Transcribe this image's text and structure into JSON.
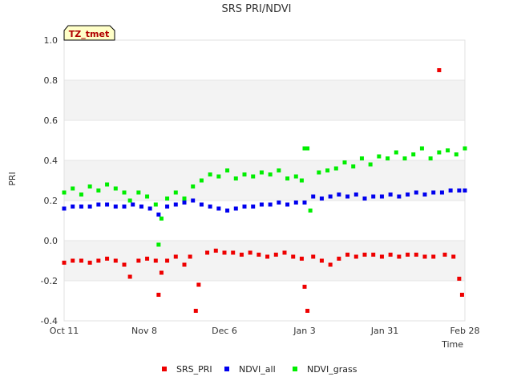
{
  "chart_data": {
    "type": "scatter",
    "title": "SRS PRI/NDVI",
    "badge": "TZ_tmet",
    "xlabel": "Time",
    "ylabel": "PRI",
    "xlim": [
      "2021-10-11",
      "2022-02-28"
    ],
    "ylim": [
      -0.4,
      1.0
    ],
    "x_ticks": [
      "Oct 11",
      "Nov 8",
      "Dec 6",
      "Jan 3",
      "Jan 31",
      "Feb 28"
    ],
    "y_ticks": [
      "-0.4",
      "-0.2",
      "0.0",
      "0.2",
      "0.4",
      "0.6",
      "0.8",
      "1.0"
    ],
    "legend_position": "bottom-center",
    "grid": "alternating horizontal bands",
    "series": [
      {
        "name": "SRS_PRI",
        "color": "#ee0000",
        "points": [
          [
            "2021-10-11",
            -0.11
          ],
          [
            "2021-10-14",
            -0.1
          ],
          [
            "2021-10-17",
            -0.1
          ],
          [
            "2021-10-20",
            -0.11
          ],
          [
            "2021-10-23",
            -0.1
          ],
          [
            "2021-10-26",
            -0.09
          ],
          [
            "2021-10-29",
            -0.1
          ],
          [
            "2021-11-01",
            -0.12
          ],
          [
            "2021-11-03",
            -0.18
          ],
          [
            "2021-11-06",
            -0.1
          ],
          [
            "2021-11-09",
            -0.09
          ],
          [
            "2021-11-12",
            -0.1
          ],
          [
            "2021-11-13",
            -0.27
          ],
          [
            "2021-11-14",
            -0.16
          ],
          [
            "2021-11-16",
            -0.1
          ],
          [
            "2021-11-19",
            -0.08
          ],
          [
            "2021-11-22",
            -0.12
          ],
          [
            "2021-11-24",
            -0.08
          ],
          [
            "2021-11-26",
            -0.35
          ],
          [
            "2021-11-27",
            -0.22
          ],
          [
            "2021-11-30",
            -0.06
          ],
          [
            "2021-12-03",
            -0.05
          ],
          [
            "2021-12-06",
            -0.06
          ],
          [
            "2021-12-09",
            -0.06
          ],
          [
            "2021-12-12",
            -0.07
          ],
          [
            "2021-12-15",
            -0.06
          ],
          [
            "2021-12-18",
            -0.07
          ],
          [
            "2021-12-21",
            -0.08
          ],
          [
            "2021-12-24",
            -0.07
          ],
          [
            "2021-12-27",
            -0.06
          ],
          [
            "2021-12-30",
            -0.08
          ],
          [
            "2022-01-02",
            -0.09
          ],
          [
            "2022-01-03",
            -0.23
          ],
          [
            "2022-01-04",
            -0.35
          ],
          [
            "2022-01-06",
            -0.08
          ],
          [
            "2022-01-09",
            -0.1
          ],
          [
            "2022-01-12",
            -0.12
          ],
          [
            "2022-01-15",
            -0.09
          ],
          [
            "2022-01-18",
            -0.07
          ],
          [
            "2022-01-21",
            -0.08
          ],
          [
            "2022-01-24",
            -0.07
          ],
          [
            "2022-01-27",
            -0.07
          ],
          [
            "2022-01-30",
            -0.08
          ],
          [
            "2022-02-02",
            -0.07
          ],
          [
            "2022-02-05",
            -0.08
          ],
          [
            "2022-02-08",
            -0.07
          ],
          [
            "2022-02-11",
            -0.07
          ],
          [
            "2022-02-14",
            -0.08
          ],
          [
            "2022-02-17",
            -0.08
          ],
          [
            "2022-02-19",
            0.85
          ],
          [
            "2022-02-21",
            -0.07
          ],
          [
            "2022-02-24",
            -0.08
          ],
          [
            "2022-02-26",
            -0.19
          ],
          [
            "2022-02-27",
            -0.27
          ]
        ]
      },
      {
        "name": "NDVI_all",
        "color": "#0000ee",
        "points": [
          [
            "2021-10-11",
            0.16
          ],
          [
            "2021-10-14",
            0.17
          ],
          [
            "2021-10-17",
            0.17
          ],
          [
            "2021-10-20",
            0.17
          ],
          [
            "2021-10-23",
            0.18
          ],
          [
            "2021-10-26",
            0.18
          ],
          [
            "2021-10-29",
            0.17
          ],
          [
            "2021-11-01",
            0.17
          ],
          [
            "2021-11-04",
            0.18
          ],
          [
            "2021-11-07",
            0.17
          ],
          [
            "2021-11-10",
            0.16
          ],
          [
            "2021-11-13",
            0.13
          ],
          [
            "2021-11-16",
            0.17
          ],
          [
            "2021-11-19",
            0.18
          ],
          [
            "2021-11-22",
            0.19
          ],
          [
            "2021-11-25",
            0.2
          ],
          [
            "2021-11-28",
            0.18
          ],
          [
            "2021-12-01",
            0.17
          ],
          [
            "2021-12-04",
            0.16
          ],
          [
            "2021-12-07",
            0.15
          ],
          [
            "2021-12-10",
            0.16
          ],
          [
            "2021-12-13",
            0.17
          ],
          [
            "2021-12-16",
            0.17
          ],
          [
            "2021-12-19",
            0.18
          ],
          [
            "2021-12-22",
            0.18
          ],
          [
            "2021-12-25",
            0.19
          ],
          [
            "2021-12-28",
            0.18
          ],
          [
            "2021-12-31",
            0.19
          ],
          [
            "2022-01-03",
            0.19
          ],
          [
            "2022-01-06",
            0.22
          ],
          [
            "2022-01-09",
            0.21
          ],
          [
            "2022-01-12",
            0.22
          ],
          [
            "2022-01-15",
            0.23
          ],
          [
            "2022-01-18",
            0.22
          ],
          [
            "2022-01-21",
            0.23
          ],
          [
            "2022-01-24",
            0.21
          ],
          [
            "2022-01-27",
            0.22
          ],
          [
            "2022-01-30",
            0.22
          ],
          [
            "2022-02-02",
            0.23
          ],
          [
            "2022-02-05",
            0.22
          ],
          [
            "2022-02-08",
            0.23
          ],
          [
            "2022-02-11",
            0.24
          ],
          [
            "2022-02-14",
            0.23
          ],
          [
            "2022-02-17",
            0.24
          ],
          [
            "2022-02-20",
            0.24
          ],
          [
            "2022-02-23",
            0.25
          ],
          [
            "2022-02-26",
            0.25
          ],
          [
            "2022-02-28",
            0.25
          ]
        ]
      },
      {
        "name": "NDVI_grass",
        "color": "#00ee00",
        "points": [
          [
            "2021-10-11",
            0.24
          ],
          [
            "2021-10-14",
            0.26
          ],
          [
            "2021-10-17",
            0.23
          ],
          [
            "2021-10-20",
            0.27
          ],
          [
            "2021-10-23",
            0.25
          ],
          [
            "2021-10-26",
            0.28
          ],
          [
            "2021-10-29",
            0.26
          ],
          [
            "2021-11-01",
            0.24
          ],
          [
            "2021-11-03",
            0.2
          ],
          [
            "2021-11-06",
            0.24
          ],
          [
            "2021-11-09",
            0.22
          ],
          [
            "2021-11-12",
            0.18
          ],
          [
            "2021-11-13",
            -0.02
          ],
          [
            "2021-11-14",
            0.11
          ],
          [
            "2021-11-16",
            0.21
          ],
          [
            "2021-11-19",
            0.24
          ],
          [
            "2021-11-22",
            0.21
          ],
          [
            "2021-11-25",
            0.27
          ],
          [
            "2021-11-28",
            0.3
          ],
          [
            "2021-12-01",
            0.33
          ],
          [
            "2021-12-04",
            0.32
          ],
          [
            "2021-12-07",
            0.35
          ],
          [
            "2021-12-10",
            0.31
          ],
          [
            "2021-12-13",
            0.33
          ],
          [
            "2021-12-16",
            0.32
          ],
          [
            "2021-12-19",
            0.34
          ],
          [
            "2021-12-22",
            0.33
          ],
          [
            "2021-12-25",
            0.35
          ],
          [
            "2021-12-28",
            0.31
          ],
          [
            "2021-12-31",
            0.32
          ],
          [
            "2022-01-02",
            0.3
          ],
          [
            "2022-01-03",
            0.46
          ],
          [
            "2022-01-04",
            0.46
          ],
          [
            "2022-01-05",
            0.15
          ],
          [
            "2022-01-08",
            0.34
          ],
          [
            "2022-01-11",
            0.35
          ],
          [
            "2022-01-14",
            0.36
          ],
          [
            "2022-01-17",
            0.39
          ],
          [
            "2022-01-20",
            0.37
          ],
          [
            "2022-01-23",
            0.41
          ],
          [
            "2022-01-26",
            0.38
          ],
          [
            "2022-01-29",
            0.42
          ],
          [
            "2022-02-01",
            0.41
          ],
          [
            "2022-02-04",
            0.44
          ],
          [
            "2022-02-07",
            0.41
          ],
          [
            "2022-02-10",
            0.43
          ],
          [
            "2022-02-13",
            0.46
          ],
          [
            "2022-02-16",
            0.41
          ],
          [
            "2022-02-19",
            0.44
          ],
          [
            "2022-02-22",
            0.45
          ],
          [
            "2022-02-25",
            0.43
          ],
          [
            "2022-02-28",
            0.46
          ]
        ]
      }
    ]
  }
}
